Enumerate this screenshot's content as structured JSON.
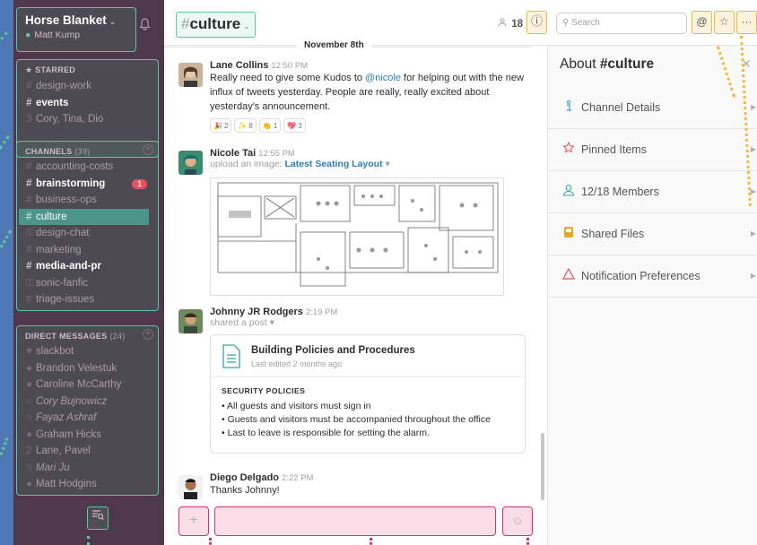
{
  "team": {
    "name": "Horse Blanket",
    "user": "Matt Kump"
  },
  "starred": {
    "header": "STARRED",
    "items": [
      {
        "prefix": "#",
        "label": "design-work",
        "style": "normal"
      },
      {
        "prefix": "#",
        "label": "events",
        "style": "bold"
      },
      {
        "prefix": "3",
        "label": "Cory, Tina, Dio",
        "style": "normal"
      }
    ]
  },
  "channels": {
    "header": "CHANNELS",
    "count": "(39)",
    "items": [
      {
        "prefix": "#",
        "label": "accounting-costs",
        "style": "normal"
      },
      {
        "prefix": "#",
        "label": "brainstorming",
        "style": "bold",
        "badge": "1"
      },
      {
        "prefix": "#",
        "label": "business-ops",
        "style": "normal"
      },
      {
        "prefix": "#",
        "label": "culture",
        "style": "active"
      },
      {
        "prefix": "🔒",
        "label": "design-chat",
        "style": "normal"
      },
      {
        "prefix": "#",
        "label": "marketing",
        "style": "normal"
      },
      {
        "prefix": "#",
        "label": "media-and-pr",
        "style": "bold"
      },
      {
        "prefix": "🔒",
        "label": "sonic-fanfic",
        "style": "normal"
      },
      {
        "prefix": "#",
        "label": "triage-issues",
        "style": "normal"
      }
    ]
  },
  "dms": {
    "header": "DIRECT MESSAGES",
    "count": "(24)",
    "items": [
      {
        "label": "slackbot",
        "presence": "heart"
      },
      {
        "label": "Brandon Velestuk",
        "presence": "on"
      },
      {
        "label": "Caroline McCarthy",
        "presence": "on"
      },
      {
        "label": "Cory Bujnowicz",
        "presence": "off",
        "italic": true
      },
      {
        "label": "Fayaz Ashraf",
        "presence": "off",
        "italic": true
      },
      {
        "label": "Graham Hicks",
        "presence": "on"
      },
      {
        "label": "Lane, Pavel",
        "presence": "group"
      },
      {
        "label": "Mari Ju",
        "presence": "off",
        "italic": true
      },
      {
        "label": "Matt Hodgins",
        "presence": "on"
      }
    ]
  },
  "header": {
    "channel": "culture",
    "members": "18",
    "search_placeholder": "Search"
  },
  "day_divider": "November 8th",
  "messages": [
    {
      "author": "Lane Collins",
      "time": "12:50 PM",
      "text_before": "Really need to give some Kudos to ",
      "mention": "@nicole",
      "text_after": " for helping out with the new influx of tweets yesterday. People are really, really excited about yesterday's announcement.",
      "reactions": [
        {
          "emoji": "🎉",
          "count": "2"
        },
        {
          "emoji": "✨",
          "count": "8"
        },
        {
          "emoji": "👏",
          "count": "1"
        },
        {
          "emoji": "💖",
          "count": "3"
        }
      ]
    },
    {
      "author": "Nicole Tai",
      "time": "12:55 PM",
      "sub_text": "upload an image: ",
      "link": "Latest Seating Layout"
    },
    {
      "author": "Johnny JR Rodgers",
      "time": "2:19 PM",
      "sub_text": "shared a post",
      "post": {
        "title": "Building Policies and Procedures",
        "edited": "Last edited 2 months ago",
        "section": "SECURITY POLICIES",
        "bullets": [
          "All guests and visitors must sign in",
          "Guests and visitors must be accompanied throughout the office",
          "Last to leave is responsible for setting the alarm."
        ]
      }
    },
    {
      "author": "Diego Delgado",
      "time": "2:22 PM",
      "text": "Thanks Johnny!"
    }
  ],
  "right_panel": {
    "title_prefix": "About ",
    "title_channel": "#culture",
    "items": [
      {
        "icon": "info-icon",
        "label": "Channel Details",
        "color": "#2d9ee0"
      },
      {
        "icon": "pin-icon",
        "label": "Pinned Items",
        "color": "#e8505b"
      },
      {
        "icon": "member-icon",
        "label": "12/18 Members",
        "color": "#3aa3a3"
      },
      {
        "icon": "files-icon",
        "label": "Shared Files",
        "color": "#e8a723"
      },
      {
        "icon": "bell-icon",
        "label": "Notification Preferences",
        "color": "#e8505b"
      }
    ]
  },
  "colors": {
    "sidebar_bg": "#4d394b",
    "active_channel": "#4c9689",
    "highlight_green": "#5cc8a0",
    "highlight_orange": "#f5b83d",
    "highlight_pink": "#d8306b",
    "page_bg": "#4f77b3"
  }
}
